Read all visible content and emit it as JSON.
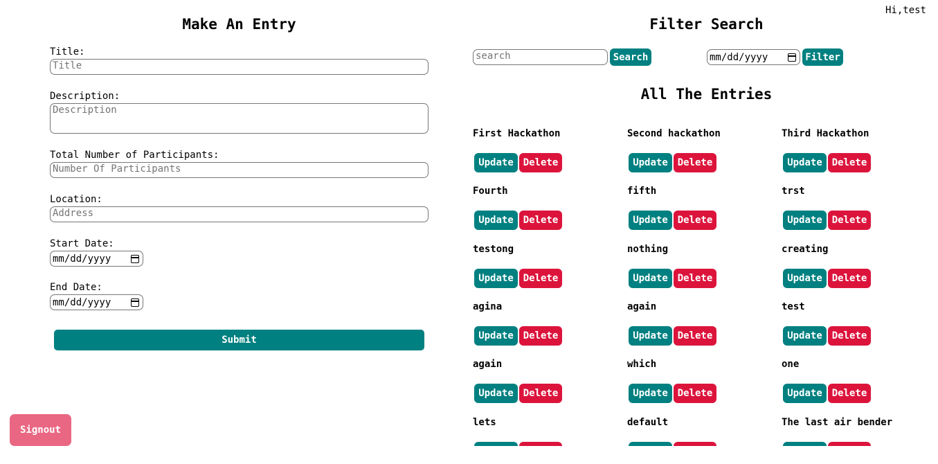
{
  "header": {
    "greeting": "Hi,test"
  },
  "form": {
    "title": "Make An Entry",
    "title_label": "Title:",
    "title_placeholder": "Title",
    "description_label": "Description:",
    "description_placeholder": "Description",
    "participants_label": "Total Number of Participants:",
    "participants_placeholder": "Number Of Participants",
    "location_label": "Location:",
    "location_placeholder": "Address",
    "start_label": "Start Date:",
    "start_placeholder": "mm/dd/yyyy",
    "end_label": "End Date:",
    "end_placeholder": "mm/dd/yyyy",
    "submit_label": "Submit"
  },
  "signout_label": "Signout",
  "filter": {
    "title": "Filter Search",
    "search_placeholder": "search",
    "search_button": "Search",
    "date_placeholder": "mm/dd/yyyy",
    "filter_button": "Filter"
  },
  "entries_title": "All The Entries",
  "entry_buttons": {
    "update": "Update",
    "delete": "Delete"
  },
  "entries": [
    "First Hackathon",
    "Second hackathon",
    "Third Hackathon",
    "Fourth",
    "fifth",
    "trst",
    "testong",
    "nothing",
    "creating",
    "agina",
    "again",
    "test",
    "again",
    "which",
    "one",
    "lets",
    "default",
    "The last air bender"
  ],
  "colors": {
    "teal": "#008080",
    "crimson": "#dc143c",
    "signout": "#ea6783"
  }
}
